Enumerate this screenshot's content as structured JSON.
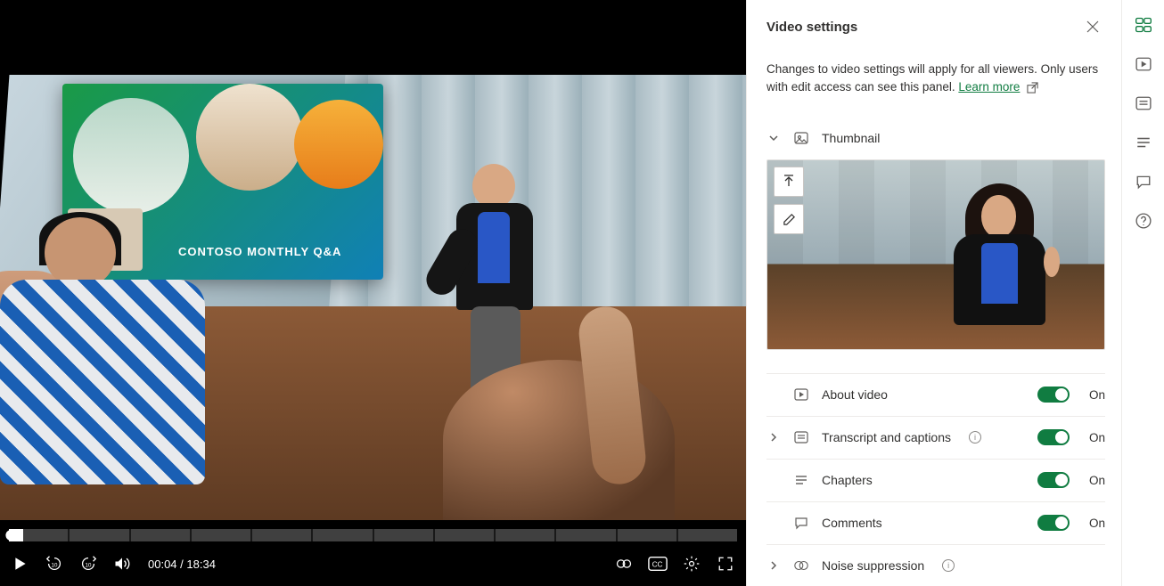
{
  "player": {
    "board_text": "CONTOSO MONTHLY Q&A",
    "time_current": "00:04",
    "time_total": "18:34",
    "time_sep": " / "
  },
  "panel": {
    "title": "Video settings",
    "description_prefix": "Changes to video settings will apply for all viewers. Only users with edit access can see this panel. ",
    "learn_more": "Learn more",
    "sections": {
      "thumbnail": {
        "label": "Thumbnail"
      },
      "about": {
        "label": "About video",
        "toggle_label": "On"
      },
      "transcript": {
        "label": "Transcript and captions",
        "toggle_label": "On"
      },
      "chapters": {
        "label": "Chapters",
        "toggle_label": "On"
      },
      "comments": {
        "label": "Comments",
        "toggle_label": "On"
      },
      "noise": {
        "label": "Noise suppression"
      }
    }
  },
  "rail_icons": {
    "settings": "video-settings-icon",
    "play": "play-icon",
    "transcript": "transcript-icon",
    "chapters": "chapters-icon",
    "comments": "comments-icon",
    "help": "help-icon"
  }
}
